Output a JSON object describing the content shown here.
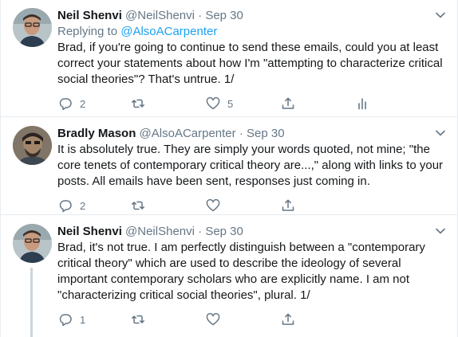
{
  "tweets": [
    {
      "name": "Neil Shenvi",
      "handle": "@NeilShenvi",
      "separator": "·",
      "time": "Sep 30",
      "replying_prefix": "Replying to ",
      "replying_to": "@AlsoACarpenter",
      "text": "Brad, if you're going to continue to send these emails, could you at least correct your statements about how I'm \"attempting to characterize critical social theories\"? That's untrue. 1/",
      "reply_count": "2",
      "retweet_count": "",
      "like_count": "5",
      "avatar_icon": "avatar-photo-neil"
    },
    {
      "name": "Bradly Mason",
      "handle": "@AlsoACarpenter",
      "separator": "·",
      "time": "Sep 30",
      "text": "It is absolutely true. They are simply your words quoted, not mine; \"the core tenets of contemporary critical theory are...,\" along with links to your posts. All emails have been sent, responses just coming in.",
      "reply_count": "2",
      "retweet_count": "",
      "like_count": "",
      "avatar_icon": "avatar-photo-bradly"
    },
    {
      "name": "Neil Shenvi",
      "handle": "@NeilShenvi",
      "separator": "·",
      "time": "Sep 30",
      "text": "Brad, it's not true. I am perfectly distinguish between a \"contemporary critical theory\" which are used to describe the ideology of several important contemporary scholars who are explicitly name. I am not \"characterizing critical social theories\", plural. 1/",
      "reply_count": "1",
      "retweet_count": "",
      "like_count": "",
      "avatar_icon": "avatar-photo-neil"
    }
  ],
  "colors": {
    "text": "#14171a",
    "secondary": "#657786",
    "link": "#1da1f2",
    "divider": "#e6ecf0",
    "thread_line": "#ccd6dd"
  },
  "icons": [
    "reply-icon",
    "retweet-icon",
    "like-icon",
    "share-icon",
    "analytics-icon",
    "chevron-down-icon"
  ]
}
